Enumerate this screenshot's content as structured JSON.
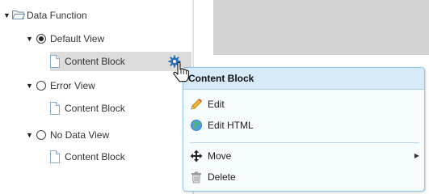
{
  "tree": {
    "root": {
      "label": "Data Function"
    },
    "views": [
      {
        "label": "Default View",
        "child": "Content Block"
      },
      {
        "label": "Error View",
        "child": "Content Block"
      },
      {
        "label": "No Data View",
        "child": "Content Block"
      }
    ]
  },
  "context_menu": {
    "title": "Content Block",
    "items": [
      {
        "label": "Edit",
        "icon": "pencil-icon"
      },
      {
        "label": "Edit HTML",
        "icon": "globe-icon"
      },
      {
        "label": "Move",
        "icon": "move-arrows-icon"
      },
      {
        "label": "Delete",
        "icon": "trash-icon"
      }
    ]
  },
  "colors": {
    "popup_border": "#8fc3e8",
    "popup_header": "#d7eaf7",
    "selection": "#dcdcdc",
    "gear": "#2a6fb5"
  }
}
